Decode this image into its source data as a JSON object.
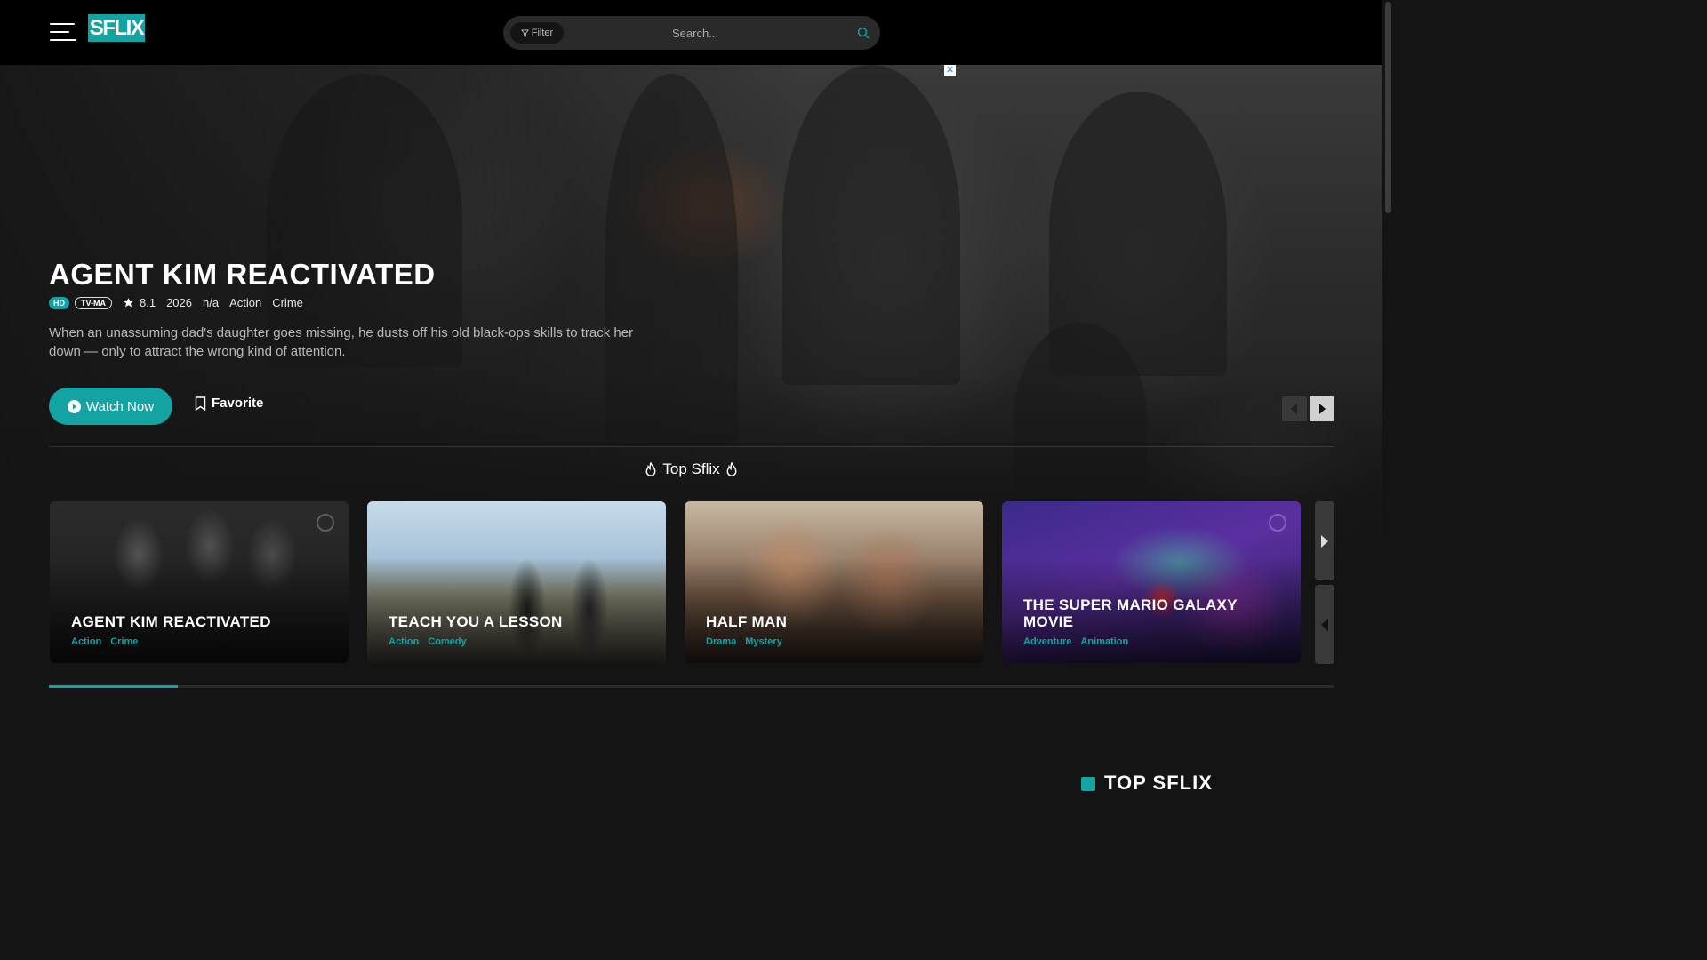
{
  "header": {
    "logo": "SFLIX",
    "filter_label": "Filter",
    "search_placeholder": "Search..."
  },
  "ad": {
    "close_label": "✕"
  },
  "hero": {
    "title": "AGENT KIM REACTIVATED",
    "quality": "HD",
    "rating_badge": "TV-MA",
    "score": "8.1",
    "year": "2026",
    "duration": "n/a",
    "genres": [
      "Action",
      "Crime"
    ],
    "description": "When an unassuming dad's daughter goes missing, he dusts off his old black-ops skills to track her down — only to attract the wrong kind of attention.",
    "watch_label": "Watch Now",
    "favorite_label": "Favorite"
  },
  "section": {
    "title": "Top Sflix"
  },
  "cards": [
    {
      "title": "AGENT KIM REACTIVATED",
      "genres": [
        "Action",
        "Crime"
      ]
    },
    {
      "title": "TEACH YOU A LESSON",
      "genres": [
        "Action",
        "Comedy"
      ]
    },
    {
      "title": "HALF MAN",
      "genres": [
        "Drama",
        "Mystery"
      ]
    },
    {
      "title": "THE SUPER MARIO GALAXY MOVIE",
      "genres": [
        "Adventure",
        "Animation"
      ]
    }
  ],
  "carousel_progress": 0.1,
  "bottom": {
    "heading": "TOP SFLIX"
  },
  "colors": {
    "accent": "#13a3a3",
    "background": "#141414",
    "header": "#000000"
  }
}
